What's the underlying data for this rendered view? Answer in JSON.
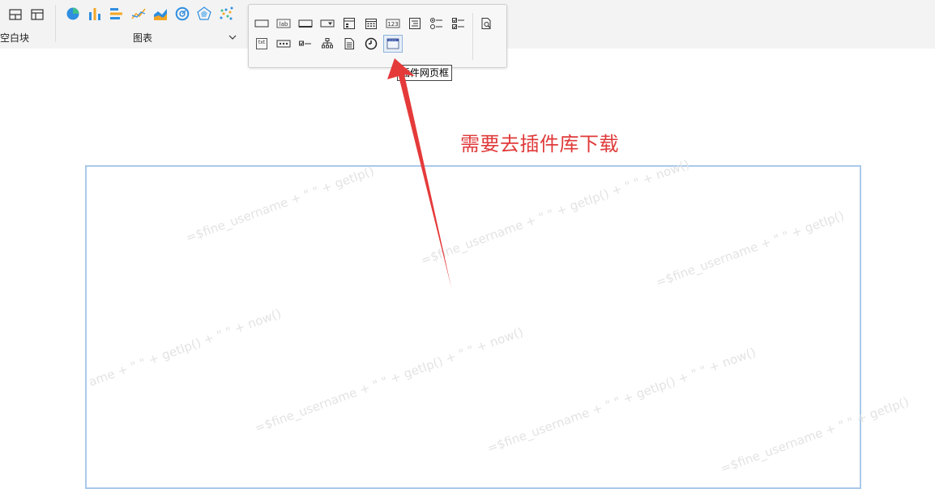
{
  "toolbar": {
    "blank_block_label": "空白块",
    "chart_group_label": "图表",
    "chart_icons": [
      "pie-chart-icon",
      "bar-chart-icon",
      "horizontal-bar-chart-icon",
      "line-chart-icon",
      "area-chart-icon",
      "gauge-chart-icon",
      "radar-chart-icon",
      "scatter-chart-icon"
    ],
    "layout_icons": [
      "split-layout-icon",
      "tab-layout-icon"
    ]
  },
  "widget_popup": {
    "row1": [
      "text-box-icon",
      "label-icon",
      "button-icon",
      "dropdown-icon",
      "dropdown-tree-icon",
      "date-icon",
      "number-icon",
      "list-icon",
      "radio-group-icon",
      "checkbox-group-icon"
    ],
    "row2": [
      "text-area-icon",
      "password-icon",
      "checkbox-icon",
      "tree-icon",
      "file-icon",
      "time-icon",
      "web-frame-icon"
    ],
    "preview_icon": "preview-icon",
    "selected": "web-frame-icon"
  },
  "tooltip": {
    "text": "插件网页框"
  },
  "annotation": {
    "text": "需要去插件库下载",
    "color": "#e03a3a"
  },
  "watermark": {
    "text_a": "=$fine_username + \" \" + getIp()",
    "text_b": "ame + \" \" + getIp() + \" \" + now()",
    "text_c": "=$fine_username + \" \" + getIp() + \" \" + now()"
  },
  "colors": {
    "canvas_border": "#a9c9ea",
    "arrow": "#e03a3a",
    "chart_blue": "#2f8ee0",
    "chart_orange": "#f5a623",
    "chart_green": "#3fbf8a"
  }
}
